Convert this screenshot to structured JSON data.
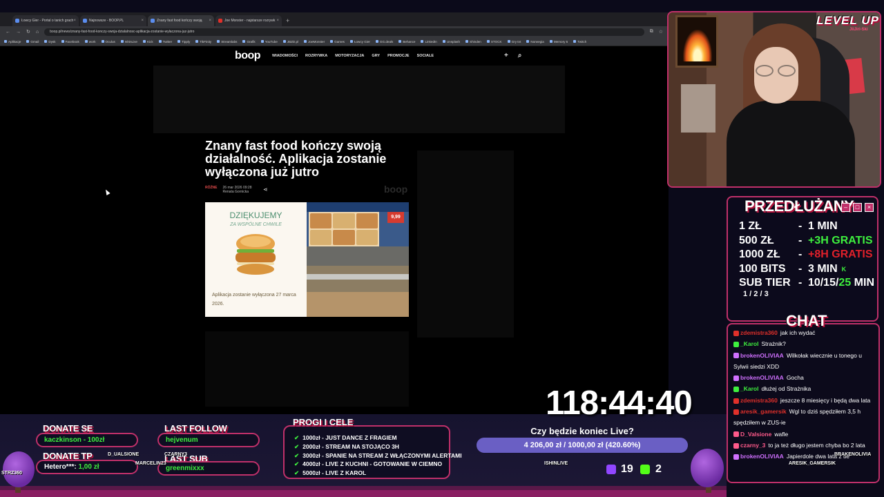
{
  "browser": {
    "tabs": [
      {
        "label": "Łowcy Gier - Portal o tanich grach"
      },
      {
        "label": "Najnowsze - BOOP.PL"
      },
      {
        "label": "Znany fast food kończy swoją"
      },
      {
        "label": "Joe Monster - najstarsze rozrywk"
      }
    ],
    "url": "boop.pl/news/znany-fast-food-konczy-swoja-dzialalnosc-aplikacja-zostanie-wylaczona-juz-jutro",
    "bookmarks": [
      "Aplikacje",
      "Gmail",
      "Dysk",
      "Facebook",
      "work",
      "Oculus",
      "IshinLive",
      "Kick",
      "Twitter",
      "Tipply",
      "TikFinity",
      "Streamlabs",
      "Grafik",
      "YouTube",
      "JBZD.pl",
      "JoeMonster",
      "Games",
      "Łowcy Gier",
      "GG.deals",
      "Behance",
      "LinkedIn",
      "Unsplash",
      "Shinden",
      "STOCK",
      "Gry tnt",
      "Norwegia",
      "Memory 5",
      "Twitch"
    ]
  },
  "site": {
    "logo": "boop",
    "nav": [
      "WIADOMOŚCI",
      "ROZRYWKA",
      "MOTORYZACJA",
      "GRY",
      "PROMOCJE",
      "SOCIALE"
    ],
    "headline": "Znany fast food kończy swoją działalność. Aplikacja zostanie wyłączona już jutro",
    "category": "RÓŻNE",
    "date": "26 mar 2026 09:28",
    "author": "Renata Gornicka",
    "watermark": "boop",
    "image": {
      "thanks": "DZIĘKUJEMY",
      "thanks_sub": "ZA WSPÓLNE CHWILE",
      "caption": "Aplikacja zostanie wyłączona 27 marca 2026.",
      "price": "9,99"
    }
  },
  "overlay": {
    "logo": "LEVEL UP",
    "logo_sub": "JiiJiri-Ski",
    "subathon": {
      "title": "PRZEDŁUŻANY",
      "rates": [
        {
          "key": "1 ZŁ",
          "value": "1 MIN"
        },
        {
          "key": "500 ZŁ",
          "value": "+3H GRATIS"
        },
        {
          "key": "1000 ZŁ",
          "value": "+8H GRATIS"
        },
        {
          "key": "100 BITS",
          "value": "3 MIN"
        }
      ],
      "subtier_key": "SUB TIER",
      "subtier_sub": "1 / 2 / 3",
      "subtier_val_a": "10/15/",
      "subtier_val_b": "25",
      "subtier_val_c": " MIN",
      "k_mark": "K"
    },
    "chat": {
      "title": "CHAT",
      "messages": [
        {
          "user": "zdemistra360",
          "text": "jak ich wydać",
          "color": "#e0302a"
        },
        {
          "user": "_Karol",
          "text": "Strażnik?",
          "color": "#3ef03e"
        },
        {
          "user": "brokenOLIVIAA",
          "text": "Wilkołak wiecznie u tonego u Sylwii siedzi XDD",
          "color": "#d070ff"
        },
        {
          "user": "brokenOLIVIAA",
          "text": "Gocha",
          "color": "#d070ff"
        },
        {
          "user": "_Karol",
          "text": "dłużej od Strażnika",
          "color": "#3ef03e"
        },
        {
          "user": "zdemistra360",
          "text": "jeszcze 8 miesięcy i będą dwa lata",
          "color": "#e0302a"
        },
        {
          "user": "aresik_gamersik",
          "text": "Wgl to dziś spędziłem 3,5 h spędziłem w ZUS-ie",
          "color": "#e0302a"
        },
        {
          "user": "D_Valsione",
          "text": "wafle",
          "color": "#ff5a8a"
        },
        {
          "user": "czarny_3",
          "text": "to ja też długo jestem chyba bo 2 lata",
          "color": "#ff5a8a"
        },
        {
          "user": "brokenOLIVIAA",
          "text": "Japierdole dwa lata z tie",
          "color": "#d070ff"
        }
      ]
    },
    "timer": "118:44:40",
    "donate_se_label": "DONATE SE",
    "donate_se_value": "kaczkinson - 100zł",
    "donate_tp_label": "DONATE TP",
    "donate_tp_value_a": "Hetero***:",
    "donate_tp_value_b": "1,00 zł",
    "last_follow_label": "LAST FOLLOW",
    "last_follow_value": "hejvenum",
    "last_sub_label": "LAST SUB",
    "last_sub_value": "greenmixxx",
    "goals": {
      "title": "PROGI I CELE",
      "items": [
        "1000zł - JUST DANCE Z FRAGIEM",
        "2000zł - STREAM NA STOJĄCO 3H",
        "3000zł - SPANIE NA STREAM Z WŁĄCZONYMI ALERTAMI",
        "4000zł - LIVE Z KUCHNI - GOTOWANIE W CIEMNO",
        "5000zł - LIVE Z KAROL"
      ]
    },
    "poll": {
      "question": "Czy będzie koniec Live?",
      "text": "4 206,00 zł / 1000,00 zł (420.60%)",
      "fill_fraction": 1.0
    },
    "stats": {
      "twitch": "19",
      "kick": "2"
    },
    "floating_names": [
      "D_UALSIONE",
      "MARCELIN23",
      "CZARNY3",
      "ISHINLIVE",
      "ARESIK_GAMERSIK",
      "BRAKENOLIVIA",
      "STRZ360"
    ],
    "colors": {
      "accent": "#c0306a",
      "green": "#3ef03e",
      "red": "#e0202a"
    }
  }
}
